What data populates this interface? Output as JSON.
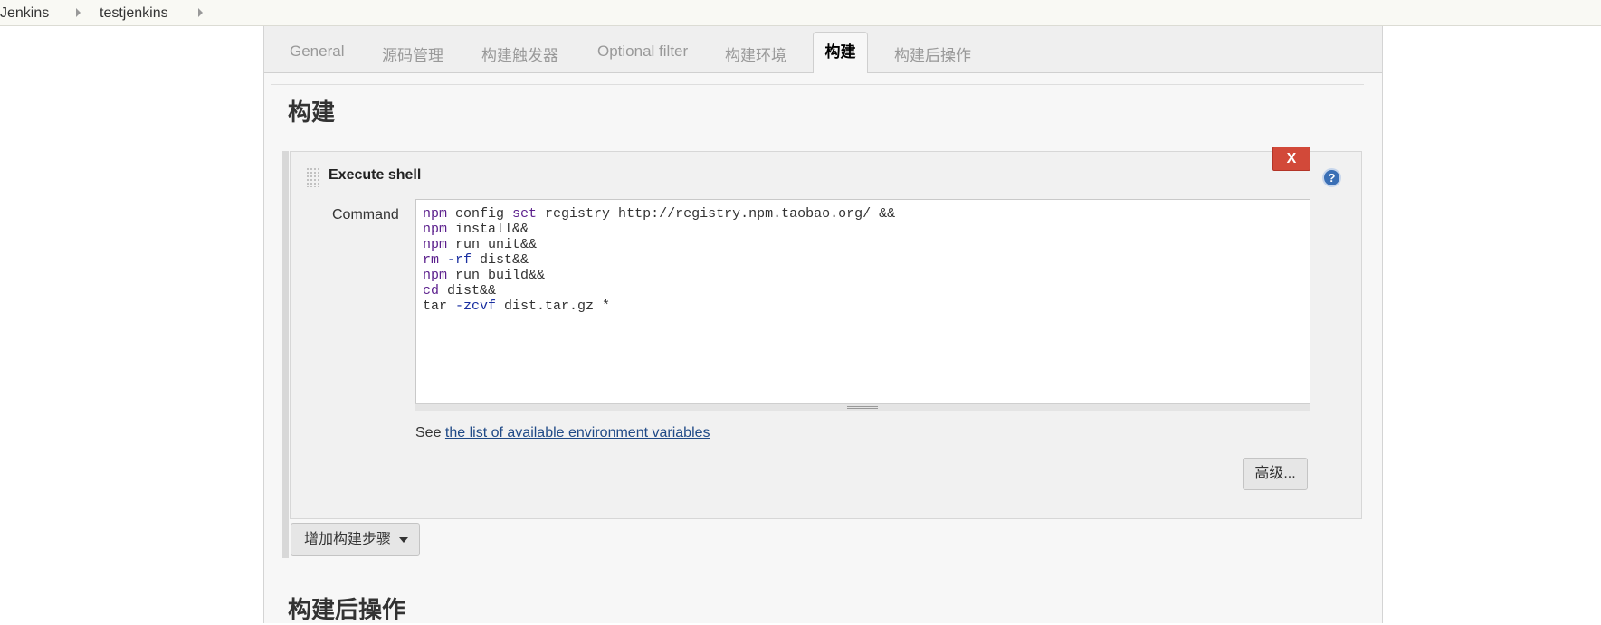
{
  "breadcrumb": {
    "items": [
      "Jenkins",
      "testjenkins"
    ]
  },
  "tabs": [
    {
      "label": "General"
    },
    {
      "label": "源码管理"
    },
    {
      "label": "构建触发器"
    },
    {
      "label": "Optional filter"
    },
    {
      "label": "构建环境"
    },
    {
      "label": "构建",
      "active": true
    },
    {
      "label": "构建后操作"
    }
  ],
  "build_section": {
    "title": "构建",
    "step": {
      "title": "Execute shell",
      "delete_label": "X",
      "help_label": "?",
      "command_label": "Command",
      "command_lines": [
        "npm config set registry http://registry.npm.taobao.org/ &&",
        "npm install&&",
        "npm run unit&&",
        "rm -rf dist&&",
        "npm run build&&",
        "cd dist&&",
        "tar -zcvf dist.tar.gz *"
      ],
      "env_prefix": "See ",
      "env_link": "the list of available environment variables",
      "advanced_label": "高级..."
    },
    "add_step_label": "增加构建步骤"
  },
  "post_build_section": {
    "title": "构建后操作"
  },
  "colors": {
    "delete_button": "#d24939",
    "help_icon": "#3a6fb5",
    "link": "#204a87",
    "keyword": "#5a1e8c"
  },
  "icons": [
    "chevron-right-icon",
    "help-icon",
    "drag-handle-icon",
    "caret-down-icon"
  ]
}
